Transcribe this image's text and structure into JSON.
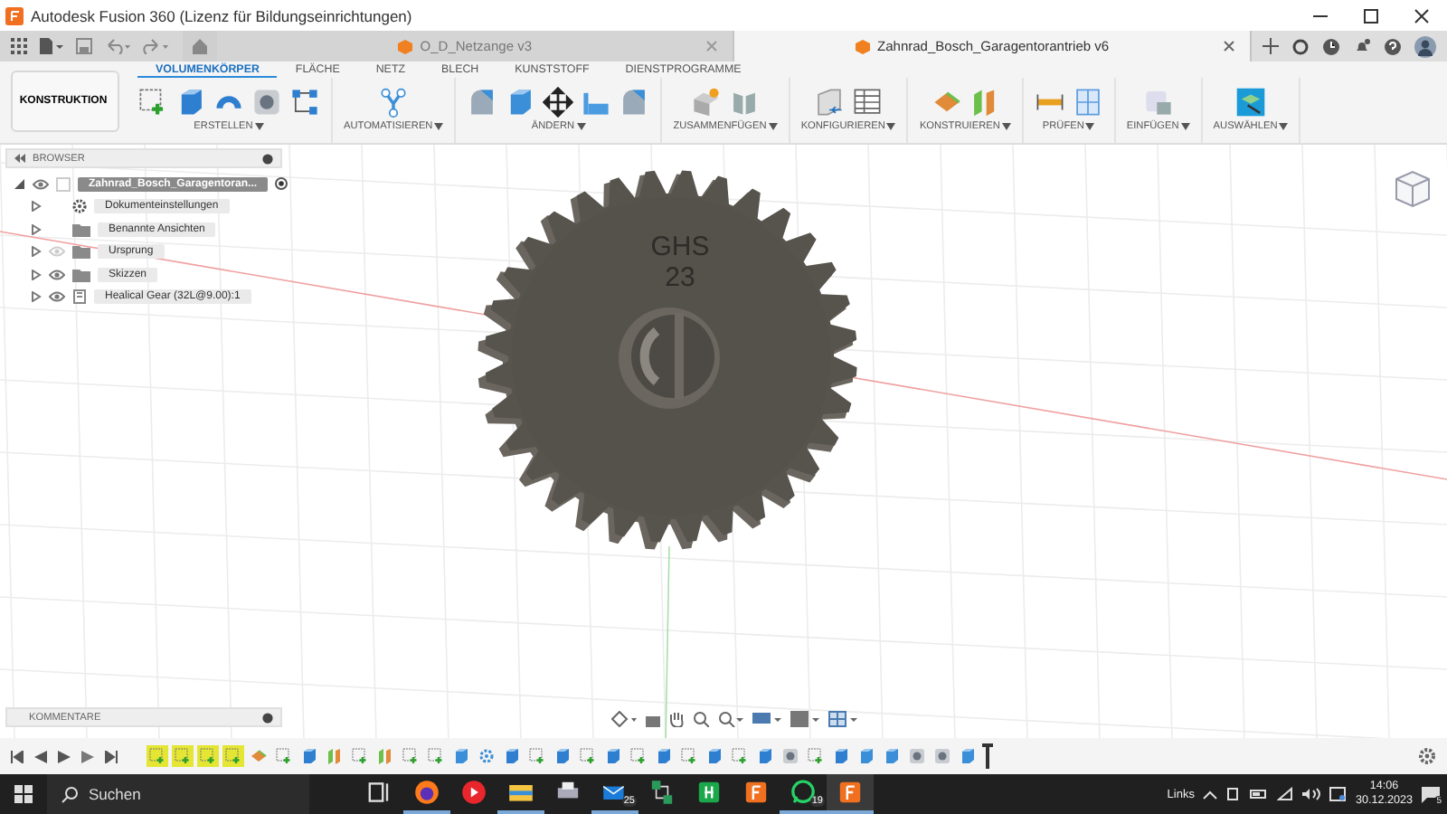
{
  "window": {
    "title": "Autodesk Fusion 360 (Lizenz für Bildungseinrichtungen)"
  },
  "doc_tabs": [
    {
      "label": "O_D_Netzange v3",
      "selected": false
    },
    {
      "label": "Zahnrad_Bosch_Garagentorantrieb v6",
      "selected": true
    }
  ],
  "workspace": {
    "label": "KONSTRUKTION"
  },
  "ribbon_tabs": [
    {
      "label": "VOLUMENKÖRPER",
      "selected": true
    },
    {
      "label": "FLÄCHE",
      "selected": false
    },
    {
      "label": "NETZ",
      "selected": false
    },
    {
      "label": "BLECH",
      "selected": false
    },
    {
      "label": "KUNSTSTOFF",
      "selected": false
    },
    {
      "label": "DIENSTPROGRAMME",
      "selected": false
    }
  ],
  "groups": [
    {
      "label": "ERSTELLEN",
      "tools": [
        {
          "kind": "sketch"
        },
        {
          "kind": "box"
        },
        {
          "kind": "revolve"
        },
        {
          "kind": "hole"
        },
        {
          "kind": "pattern"
        }
      ]
    },
    {
      "label": "AUTOMATISIEREN",
      "tools": [
        {
          "kind": "automate"
        }
      ]
    },
    {
      "label": "ÄNDERN",
      "tools": [
        {
          "kind": "fillet"
        },
        {
          "kind": "press"
        },
        {
          "kind": "move"
        },
        {
          "kind": "align"
        },
        {
          "kind": "chamfer"
        }
      ]
    },
    {
      "label": "ZUSAMMENFÜGEN",
      "tools": [
        {
          "kind": "joint"
        },
        {
          "kind": "hinge"
        }
      ]
    },
    {
      "label": "KONFIGURIEREN",
      "tools": [
        {
          "kind": "params"
        },
        {
          "kind": "table"
        }
      ]
    },
    {
      "label": "KONSTRUIEREN",
      "tools": [
        {
          "kind": "plane"
        },
        {
          "kind": "split"
        }
      ]
    },
    {
      "label": "PRÜFEN",
      "tools": [
        {
          "kind": "measure"
        },
        {
          "kind": "section"
        }
      ]
    },
    {
      "label": "EINFÜGEN",
      "tools": [
        {
          "kind": "insert"
        }
      ]
    },
    {
      "label": "AUSWÄHLEN",
      "tools": [
        {
          "kind": "select"
        }
      ]
    }
  ],
  "browser": {
    "title": "BROWSER",
    "root": {
      "label": "Zahnrad_Bosch_Garagentoran...",
      "visible": true,
      "expanded": true,
      "selected": true,
      "children": [
        {
          "label": "Dokumenteinstellungen",
          "kind": "settings",
          "expanded": false,
          "selected": false
        },
        {
          "label": "Benannte Ansichten",
          "kind": "folder",
          "expanded": false,
          "selected": false
        },
        {
          "label": "Ursprung",
          "kind": "folder",
          "visible": false,
          "expanded": false,
          "selected": false
        },
        {
          "label": "Skizzen",
          "kind": "folder",
          "visible": true,
          "expanded": false,
          "selected": false
        },
        {
          "label": "Healical Gear (32L@9.00):1",
          "kind": "component",
          "visible": true,
          "expanded": false,
          "selected": false
        }
      ]
    }
  },
  "model": {
    "engraving": [
      "GHS",
      "23"
    ]
  },
  "comments": {
    "title": "KOMMENTARE"
  },
  "timeline": [
    {
      "kind": "sketch",
      "selected": true
    },
    {
      "kind": "sketch",
      "selected": true
    },
    {
      "kind": "sketch",
      "selected": true
    },
    {
      "kind": "sketch",
      "selected": true
    },
    {
      "kind": "plane",
      "selected": false
    },
    {
      "kind": "sketch",
      "selected": false
    },
    {
      "kind": "box",
      "selected": false
    },
    {
      "kind": "split",
      "selected": false
    },
    {
      "kind": "sketch",
      "selected": false
    },
    {
      "kind": "split",
      "selected": false
    },
    {
      "kind": "sketch",
      "selected": false
    },
    {
      "kind": "sketch",
      "selected": false
    },
    {
      "kind": "press",
      "selected": false
    },
    {
      "kind": "gear",
      "selected": false
    },
    {
      "kind": "box",
      "selected": false
    },
    {
      "kind": "sketch",
      "selected": false
    },
    {
      "kind": "box",
      "selected": false
    },
    {
      "kind": "sketch",
      "selected": false
    },
    {
      "kind": "box",
      "selected": false
    },
    {
      "kind": "sketch",
      "selected": false
    },
    {
      "kind": "box",
      "selected": false
    },
    {
      "kind": "sketch",
      "selected": false
    },
    {
      "kind": "box",
      "selected": false
    },
    {
      "kind": "sketch",
      "selected": false
    },
    {
      "kind": "box",
      "selected": false
    },
    {
      "kind": "shape",
      "selected": false
    },
    {
      "kind": "sketch",
      "selected": false
    },
    {
      "kind": "box",
      "selected": false
    },
    {
      "kind": "press",
      "selected": false
    },
    {
      "kind": "press",
      "selected": false
    },
    {
      "kind": "shape",
      "selected": false
    },
    {
      "kind": "shape",
      "selected": false
    },
    {
      "kind": "press",
      "selected": false
    }
  ],
  "taskbar": {
    "search": {
      "placeholder": "Suchen"
    },
    "apps": [
      {
        "kind": "taskview",
        "running": false,
        "selected": false
      },
      {
        "kind": "browser",
        "running": true,
        "selected": false
      },
      {
        "kind": "video",
        "running": false,
        "selected": false
      },
      {
        "kind": "files",
        "running": true,
        "selected": false
      },
      {
        "kind": "printer",
        "running": false,
        "selected": false
      },
      {
        "kind": "mail",
        "running": true,
        "selected": false,
        "badge": "25"
      },
      {
        "kind": "network",
        "running": false,
        "selected": false
      },
      {
        "kind": "sheet",
        "running": false,
        "selected": false
      },
      {
        "kind": "cad",
        "running": false,
        "selected": false
      },
      {
        "kind": "chat",
        "running": true,
        "selected": false,
        "badge": "19"
      },
      {
        "kind": "cad",
        "running": true,
        "selected": true
      }
    ],
    "tray": {
      "language": "Links",
      "time": "14:06",
      "date": "30.12.2023",
      "notifications": "5"
    }
  }
}
